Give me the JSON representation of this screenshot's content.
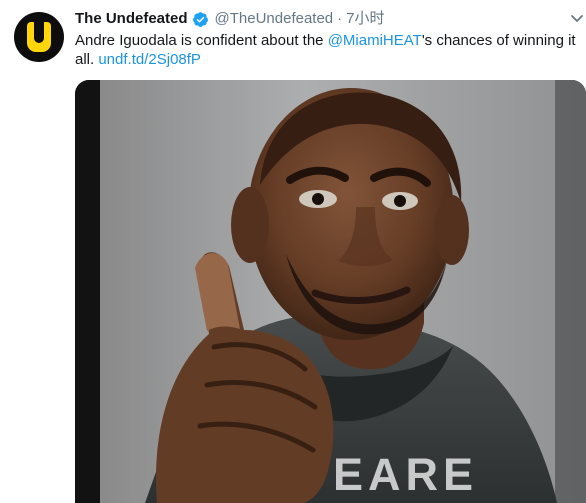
{
  "tweet": {
    "author_name": "The Undefeated",
    "author_handle": "@TheUndefeated",
    "separator": "·",
    "timestamp": "7小时",
    "text_before_mention": "Andre Iguodala is confident about the ",
    "mention": "@MiamiHEAT",
    "text_after_mention": "'s chances of winning it all. ",
    "link_text": "undf.td/2Sj08fP",
    "icons": {
      "avatar": "undefeated-logo",
      "verified": "verified-badge-icon",
      "more": "chevron-down-icon"
    },
    "media_text": "EARE"
  },
  "colors": {
    "accent": "#1b95e0",
    "secondary_text": "#657786",
    "primary_text": "#14171a",
    "logo_yellow": "#ffd60a"
  }
}
